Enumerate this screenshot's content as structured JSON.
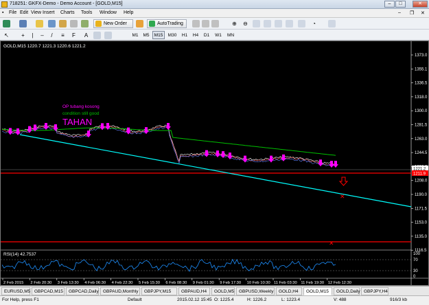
{
  "window": {
    "title": "718251: GKFX-Demo - Demo Account - [GOLD,M15]"
  },
  "menu": [
    "File",
    "Edit",
    "View",
    "Insert",
    "Charts",
    "Tools",
    "Window",
    "Help"
  ],
  "toolbar": {
    "new_order": "New Order",
    "autotrading": "AutoTrading"
  },
  "timeframes": [
    "M1",
    "M5",
    "M15",
    "M30",
    "H1",
    "H4",
    "D1",
    "W1",
    "MN"
  ],
  "active_timeframe": "M15",
  "chart": {
    "header": "GOLD,M15  1220.7 1221.3 1220.6 1221.2",
    "price_labels": [
      "1373.0",
      "1355.1",
      "1336.5",
      "1318.0",
      "1300.0",
      "1281.5",
      "1263.0",
      "1244.5",
      "1226.0",
      "1208.0",
      "1190.0",
      "1171.5",
      "1153.0",
      "1135.0",
      "1116.5"
    ],
    "current_price": "1221.2",
    "line_price": "1211.9",
    "annotations": {
      "line1": "OP tubang kosong",
      "line2": "condition still good",
      "line3": "TAHAN"
    },
    "time_labels": [
      "2 Feb 2015",
      "2 Feb 20:30",
      "3 Feb 13:30",
      "4 Feb 06:30",
      "4 Feb 22:30",
      "5 Feb 15:30",
      "6 Feb 08:30",
      "9 Feb 01:30",
      "9 Feb 17:30",
      "10 Feb 10:30",
      "11 Feb 03:30",
      "11 Feb 19:30",
      "12 Feb 12:30"
    ],
    "rsi": {
      "label": "RSI(14) 42.7537",
      "levels": [
        "100",
        "70",
        "30",
        "0"
      ]
    },
    "colors": {
      "background": "#000000",
      "trendline": "#00ffff",
      "hline": "#ff0000",
      "marker": "#ff00ff",
      "ma_green": "#00c000",
      "rsi_line": "#1e90ff",
      "annotation": "#ff00ff",
      "annotation2": "#00c000"
    }
  },
  "symbol_tabs": [
    "EURUSD,M5",
    "GBPCAD,M15",
    "GBPCAD,Daily",
    "GBPAUD,Monthly",
    "GBPJPY,M15",
    "GBPAUD,H4",
    "GOLD,M5",
    "GBPUSD,Weekly",
    "GOLD,H4",
    "GOLD,M15",
    "GOLD,Daily",
    "GBPJPY,H4"
  ],
  "active_symbol_tab": "GOLD,M15",
  "status": {
    "help": "For Help, press F1",
    "profile": "Default",
    "datetime": "2015.02.12 15:45",
    "open": "O: 1225.4",
    "high": "H: 1226.2",
    "low": "L: 1223.4",
    "volume": "V: 488",
    "traffic": "916/3 kb"
  }
}
